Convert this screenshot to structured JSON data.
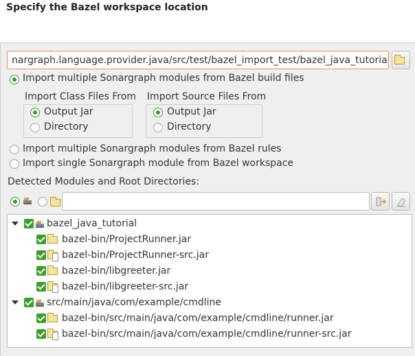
{
  "header": {
    "title": "Specify the Bazel workspace location"
  },
  "workspace": {
    "path": "nargraph.language.provider.java/src/test/bazel_import_test/bazel_java_tutorial"
  },
  "import_options": [
    {
      "label": "Import multiple Sonargraph modules from Bazel build files",
      "selected": true
    },
    {
      "label": "Import multiple Sonargraph modules from Bazel rules",
      "selected": false
    },
    {
      "label": "Import single Sonargraph module from Bazel workspace",
      "selected": false
    }
  ],
  "class_files": {
    "title": "Import Class Files From",
    "options": [
      "Output Jar",
      "Directory"
    ],
    "selected": "Output Jar"
  },
  "source_files": {
    "title": "Import Source Files From",
    "options": [
      "Output Jar",
      "Directory"
    ],
    "selected": "Output Jar"
  },
  "detected": {
    "label": "Detected Modules and Root Directories:"
  },
  "filter": {
    "value": ""
  },
  "tree": {
    "modules": [
      {
        "name": "bazel_java_tutorial",
        "expanded": true,
        "checked": true,
        "children": [
          {
            "name": "bazel-bin/ProjectRunner.jar",
            "kind": "class",
            "checked": true
          },
          {
            "name": "bazel-bin/ProjectRunner-src.jar",
            "kind": "source",
            "checked": true
          },
          {
            "name": "bazel-bin/libgreeter.jar",
            "kind": "class",
            "checked": true
          },
          {
            "name": "bazel-bin/libgreeter-src.jar",
            "kind": "source",
            "checked": true
          }
        ]
      },
      {
        "name": "src/main/java/com/example/cmdline",
        "expanded": true,
        "checked": true,
        "children": [
          {
            "name": "bazel-bin/src/main/java/com/example/cmdline/runner.jar",
            "kind": "class",
            "checked": true
          },
          {
            "name": "bazel-bin/src/main/java/com/example/cmdline/runner-src.jar",
            "kind": "source",
            "checked": true
          }
        ]
      }
    ]
  },
  "icons": {
    "browse": "folder-icon",
    "apply_filter": "filter-apply-icon",
    "clear_filter": "clear-filter-icon",
    "module": "module-icon",
    "directory": "folder-icon",
    "source_directory": "source-folder-icon"
  },
  "colors": {
    "accent": "#3aa02c",
    "focus_border": "#f08a4b"
  }
}
